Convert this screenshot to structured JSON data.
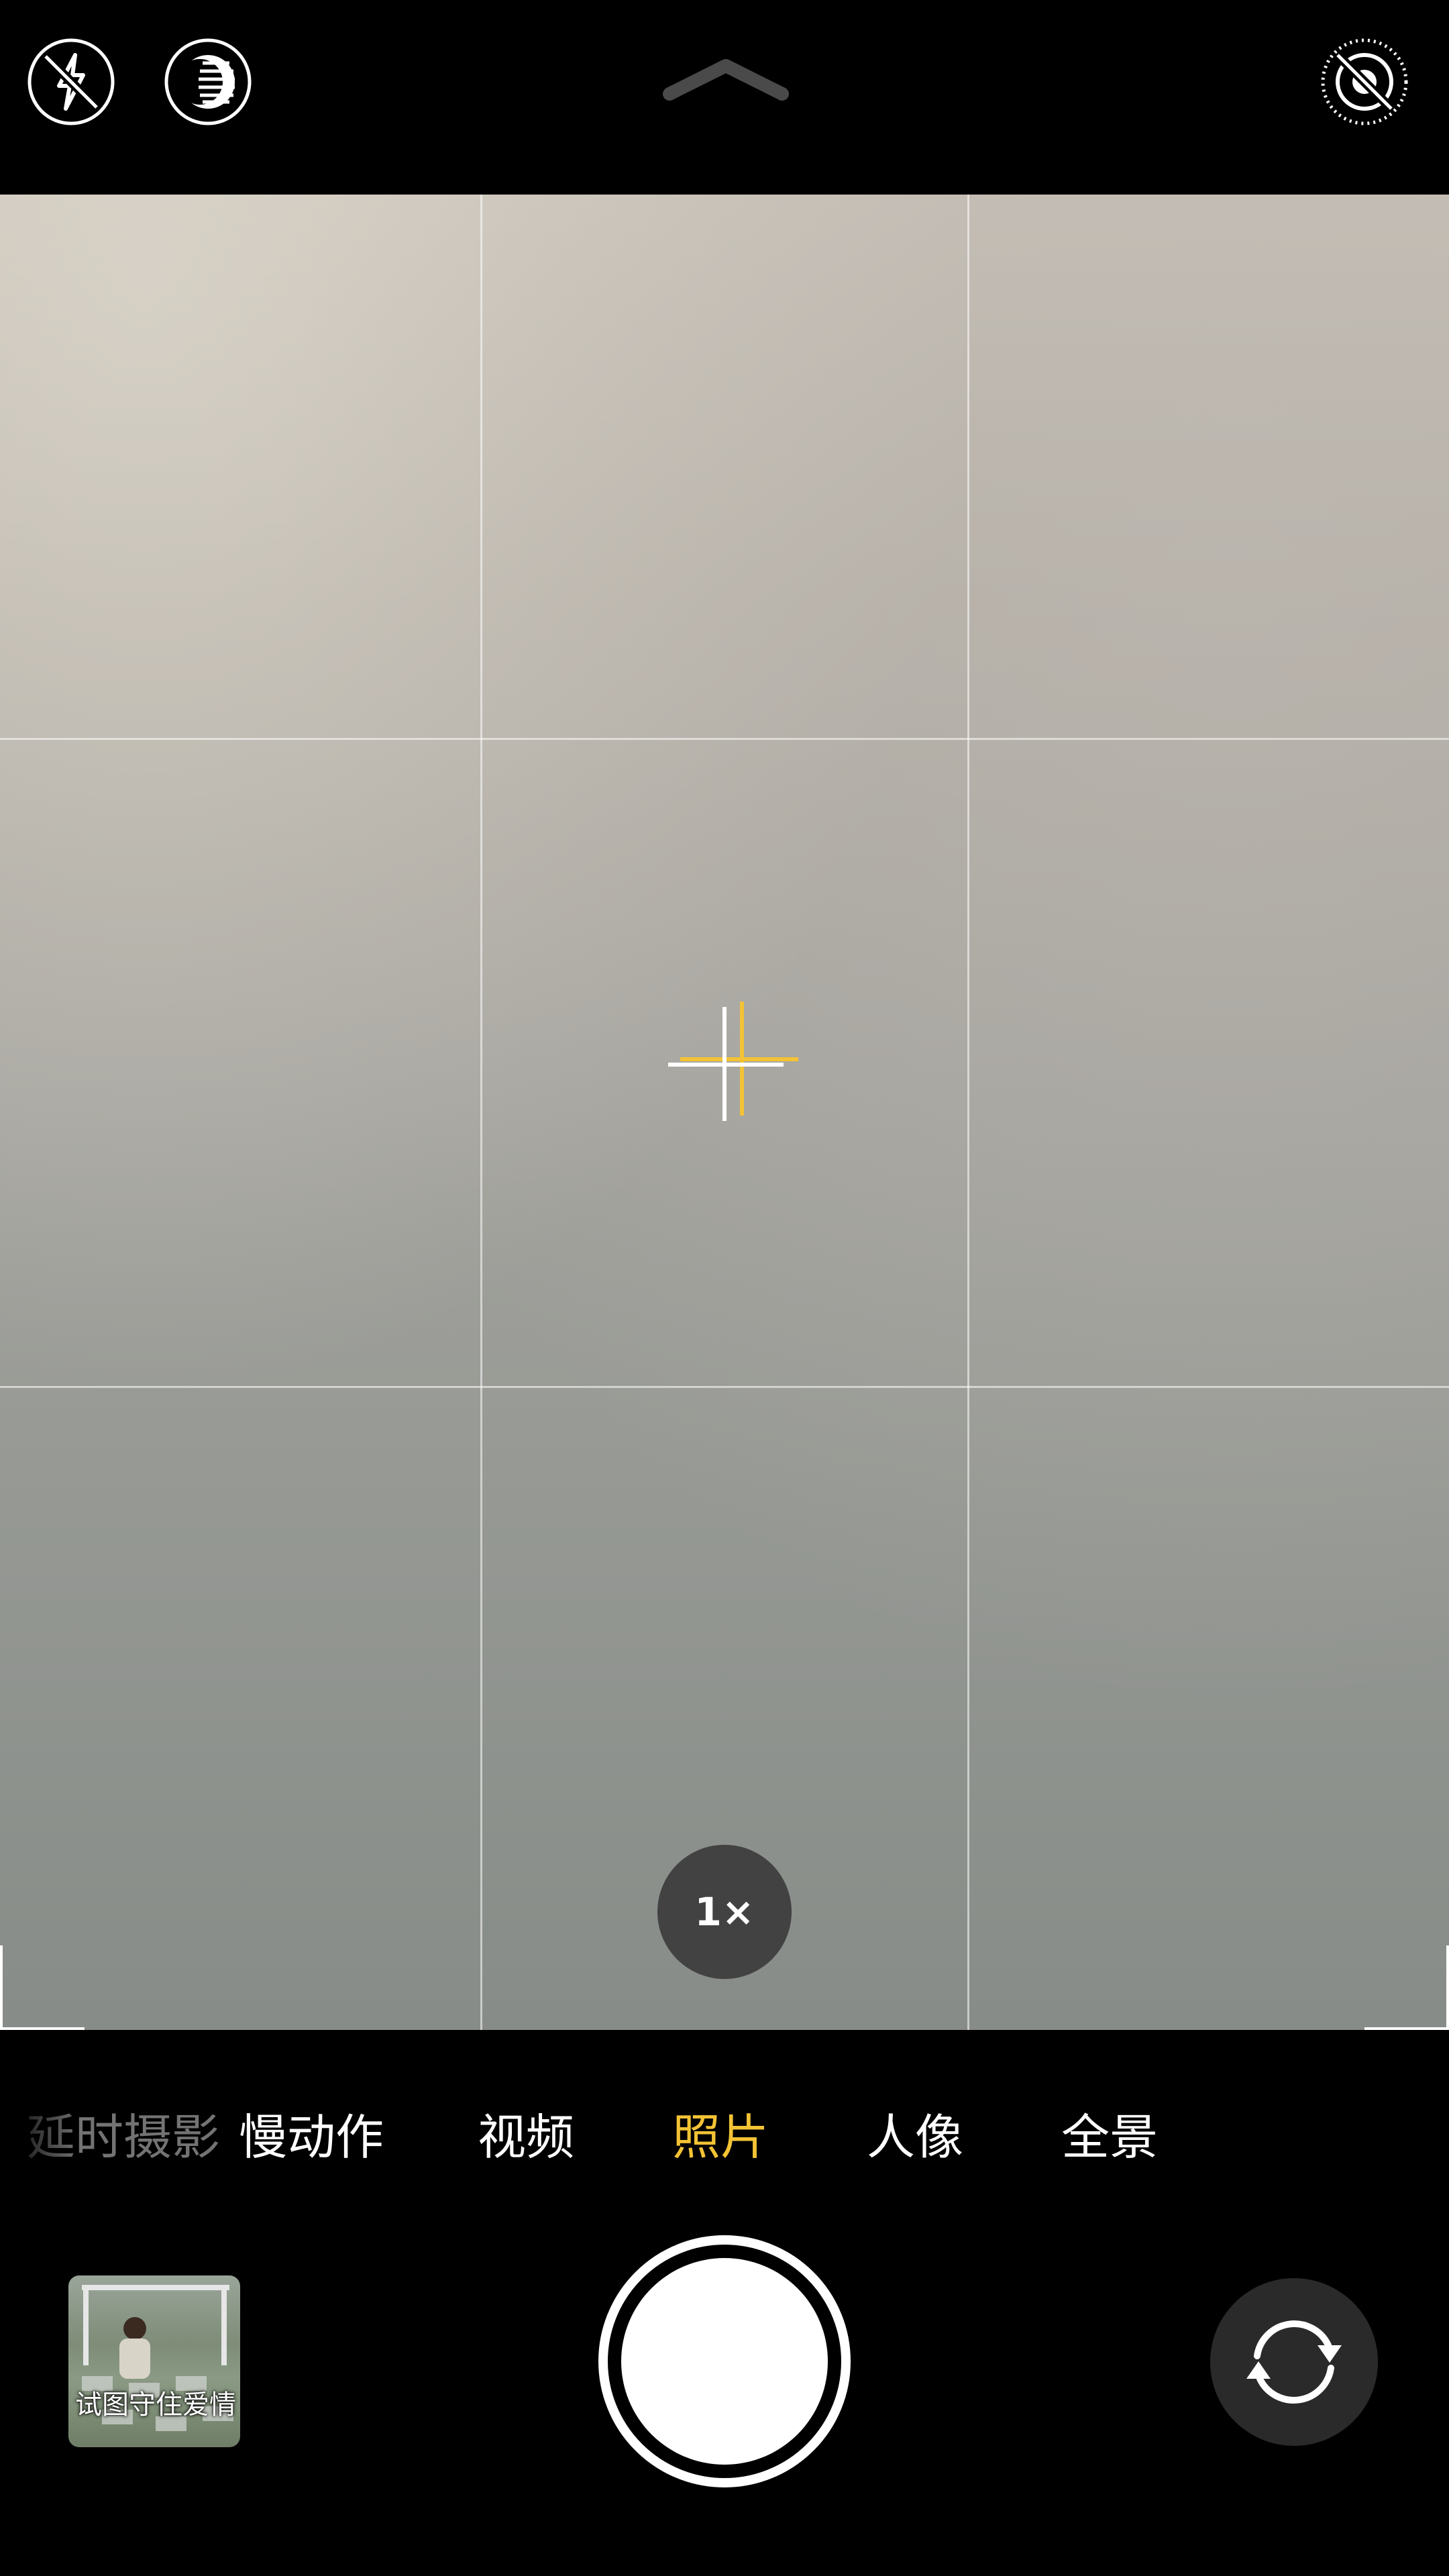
{
  "top_bar": {
    "flash_icon": "flash-off-icon",
    "live_icon": "live-photo-icon",
    "chevron_icon": "chevron-up-icon",
    "filter_icon": "live-off-icon"
  },
  "viewfinder": {
    "zoom_label": "1×",
    "focus_color": "#f3c335"
  },
  "modes": {
    "items": [
      {
        "label": "延时摄影"
      },
      {
        "label": "慢动作"
      },
      {
        "label": "视频"
      },
      {
        "label": "照片"
      },
      {
        "label": "人像"
      },
      {
        "label": "全景"
      }
    ],
    "selected": "照片",
    "selected_color": "#f3c335"
  },
  "thumbnail": {
    "caption": "试图守住爱情"
  },
  "controls": {
    "shutter_icon": "shutter-button",
    "flip_icon": "camera-flip-icon"
  }
}
